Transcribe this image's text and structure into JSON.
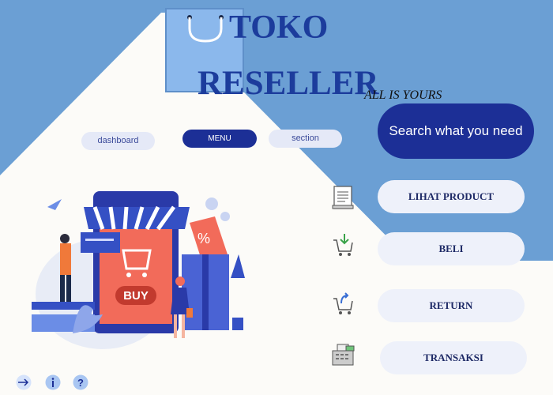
{
  "brand": {
    "title_line1": "TOKO",
    "title_line2": "RESELLER",
    "tagline": "ALL IS YOURS",
    "logo_icon": "shopping-bag-icon"
  },
  "nav": {
    "dashboard_label": "dashboard",
    "menu_label": "MENU",
    "section_label": "section"
  },
  "search": {
    "label": "Search what you need"
  },
  "illustration": {
    "buy_text": "BUY",
    "percent_text": "%"
  },
  "actions": [
    {
      "label": "LIHAT PRODUCT",
      "icon": "receipt-icon"
    },
    {
      "label": "BELI",
      "icon": "cart-add-icon"
    },
    {
      "label": "RETURN",
      "icon": "cart-return-icon"
    },
    {
      "label": "TRANSAKSI",
      "icon": "cash-register-icon"
    }
  ],
  "footer_icons": [
    "logout-icon",
    "info-icon",
    "help-icon"
  ],
  "colors": {
    "background_blue": "#6b9fd4",
    "primary_navy": "#1c2f96",
    "title_blue": "#1c3c9c",
    "pill_light": "#eef1fa"
  }
}
